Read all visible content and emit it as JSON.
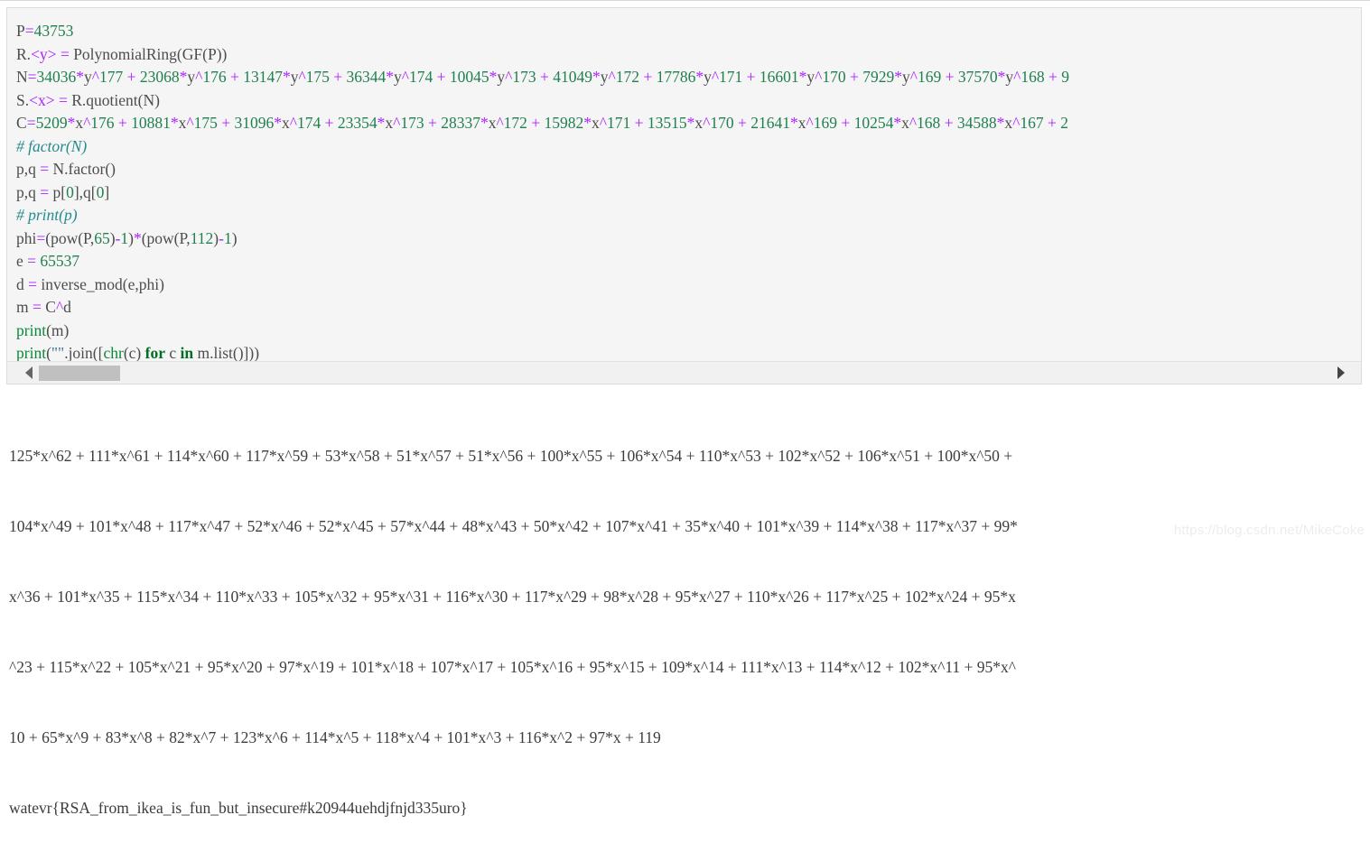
{
  "code_block": {
    "language": "python",
    "background_color": "#f5f5f5",
    "border_color": "#dcdcdc",
    "lines": [
      "P=43753",
      "R.<y> = PolynomialRing(GF(P))",
      "N=34036*y^177 + 23068*y^176 + 13147*y^175 + 36344*y^174 + 10045*y^173 + 41049*y^172 + 17786*y^171 + 16601*y^170 + 7929*y^169 + 37570*y^168 + ",
      "S.<x> = R.quotient(N)",
      "C=5209*x^176 + 10881*x^175 + 31096*x^174 + 23354*x^173 + 28337*x^172 + 15982*x^171 + 13515*x^170 + 21641*x^169 + 10254*x^168 + 34588*x^167 + ",
      "# factor(N)",
      "p,q = N.factor()",
      "p,q = p[0],q[0]",
      "# print(p)",
      "phi=(pow(P,65)-1)*(pow(P,112)-1)",
      "e = 65537",
      "d = inverse_mod(e,phi)",
      "m = C^d",
      "print(m)",
      "print(\"\".join([chr(c) for c in m.list()]))"
    ]
  },
  "scrollbar": {
    "left_arrow_icon": "triangle-left-icon",
    "right_arrow_icon": "triangle-right-icon",
    "thumb_color": "#c0c0c0",
    "track_color": "#f1f1f1",
    "orientation": "horizontal"
  },
  "output": {
    "lines": [
      "125*x^62 + 111*x^61 + 114*x^60 + 117*x^59 + 53*x^58 + 51*x^57 + 51*x^56 + 100*x^55 + 106*x^54 + 110*x^53 + 102*x^52 + 106*x^51 + 100*x^50 + ",
      "104*x^49 + 101*x^48 + 117*x^47 + 52*x^46 + 52*x^45 + 57*x^44 + 48*x^43 + 50*x^42 + 107*x^41 + 35*x^40 + 101*x^39 + 114*x^38 + 117*x^37 + 99*",
      "x^36 + 101*x^35 + 115*x^34 + 110*x^33 + 105*x^32 + 95*x^31 + 116*x^30 + 117*x^29 + 98*x^28 + 95*x^27 + 110*x^26 + 117*x^25 + 102*x^24 + 95*x",
      "^23 + 115*x^22 + 105*x^21 + 95*x^20 + 97*x^19 + 101*x^18 + 107*x^17 + 105*x^16 + 95*x^15 + 109*x^14 + 111*x^13 + 114*x^12 + 102*x^11 + 95*x^",
      "10 + 65*x^9 + 83*x^8 + 82*x^7 + 123*x^6 + 114*x^5 + 118*x^4 + 101*x^3 + 116*x^2 + 97*x + 119",
      "watevr{RSA_from_ikea_is_fun_but_insecure#k20944uehdjfnjd335uro}"
    ]
  },
  "watermark": {
    "text": "https://blog.csdn.net/MikeCoke"
  },
  "colors": {
    "operator": "#aa22ff",
    "number": "#208050",
    "comment": "#268b8b",
    "function": "#0a8a36",
    "keyword": "#007020",
    "identifier": "#4d4d4d",
    "output_text": "#3c3c3c"
  }
}
